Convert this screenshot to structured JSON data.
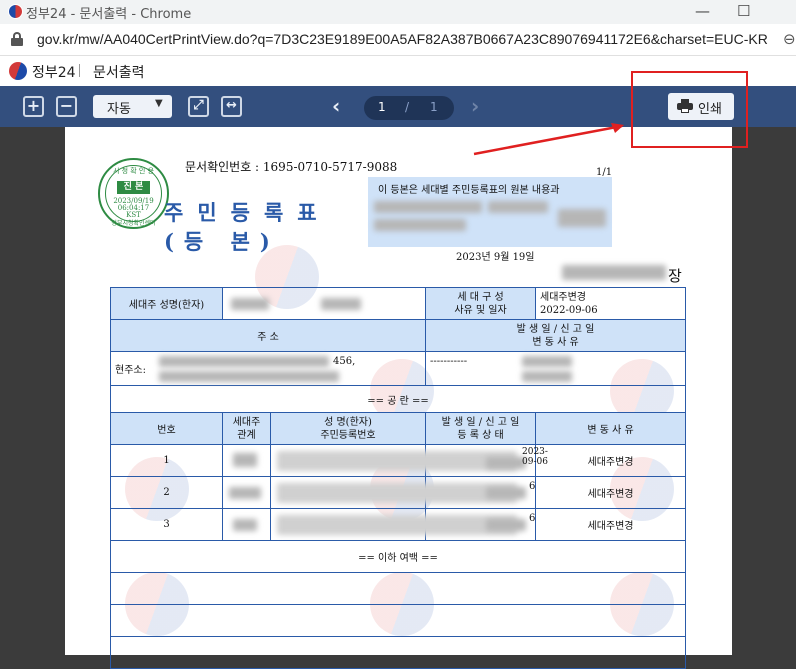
{
  "window": {
    "title": "정부24 - 문서출력 - Chrome",
    "minimize": "—",
    "maximize": "☐"
  },
  "address_bar": {
    "url": "gov.kr/mw/AA040CertPrintView.do?q=7D3C23E9189E00A5AF82A387B0667A23C89076941172E6&charset=EUC-KR"
  },
  "site_header": {
    "brand": "정부24",
    "separator": "|",
    "page_title": "문서출력"
  },
  "toolbar": {
    "zoom_in": "+",
    "zoom_out": "−",
    "zoom_select": "자동",
    "zoom_caret": "▼",
    "fit_page": "⤢",
    "fit_width": "↔",
    "prev": "‹",
    "next": "›",
    "current_page": "1",
    "page_sep": "/",
    "total_pages": "1",
    "print_label": "인쇄"
  },
  "document": {
    "doc_number": "문서확인번호 : 1695-0710-5717-9088",
    "page_index": "1/1",
    "seal": {
      "top_text": "시 청 확 인 용",
      "main": "진 본",
      "date": "2023/09/19",
      "time": "06:04:17",
      "tz": "KST",
      "bottom_text": "정부시청확인센터"
    },
    "copy_notice": "이 등본은 세대별 주민등록표의 원본 내용과",
    "title_line1": "주민등록표",
    "title_line2": "(등 본)",
    "issue_date": "2023년 9월 19일",
    "issuer_suffix": "장",
    "table": {
      "householder_label": "세대주 성명(한자)",
      "household_comp_label": "세 대 구 성\n사유 및 일자",
      "household_comp_value": "세대주변경\n2022-09-06",
      "address_header": "주 소",
      "address_dates_header": "발 생 일 / 신 고 일\n변 동 사 유",
      "current_address_label": "현주소:",
      "address_partial": "456,",
      "address_dashes": "-----------",
      "section_label": "== 공 란 ==",
      "col_no": "번호",
      "col_relation": "세대주\n관계",
      "col_name": "성 명(한자)\n주민등록번호",
      "col_dates": "발 생 일 / 신 고 일\n등 록 상 태",
      "col_reason": "변 동 사 유",
      "rows": [
        {
          "no": "1",
          "date_partial": "2023-09-06",
          "reason": "세대주변경"
        },
        {
          "no": "2",
          "date_partial": "6",
          "reason": "세대주변경"
        },
        {
          "no": "3",
          "date_partial": "6",
          "reason": "세대주변경"
        }
      ],
      "end_marker": "== 이하 여백 =="
    }
  }
}
